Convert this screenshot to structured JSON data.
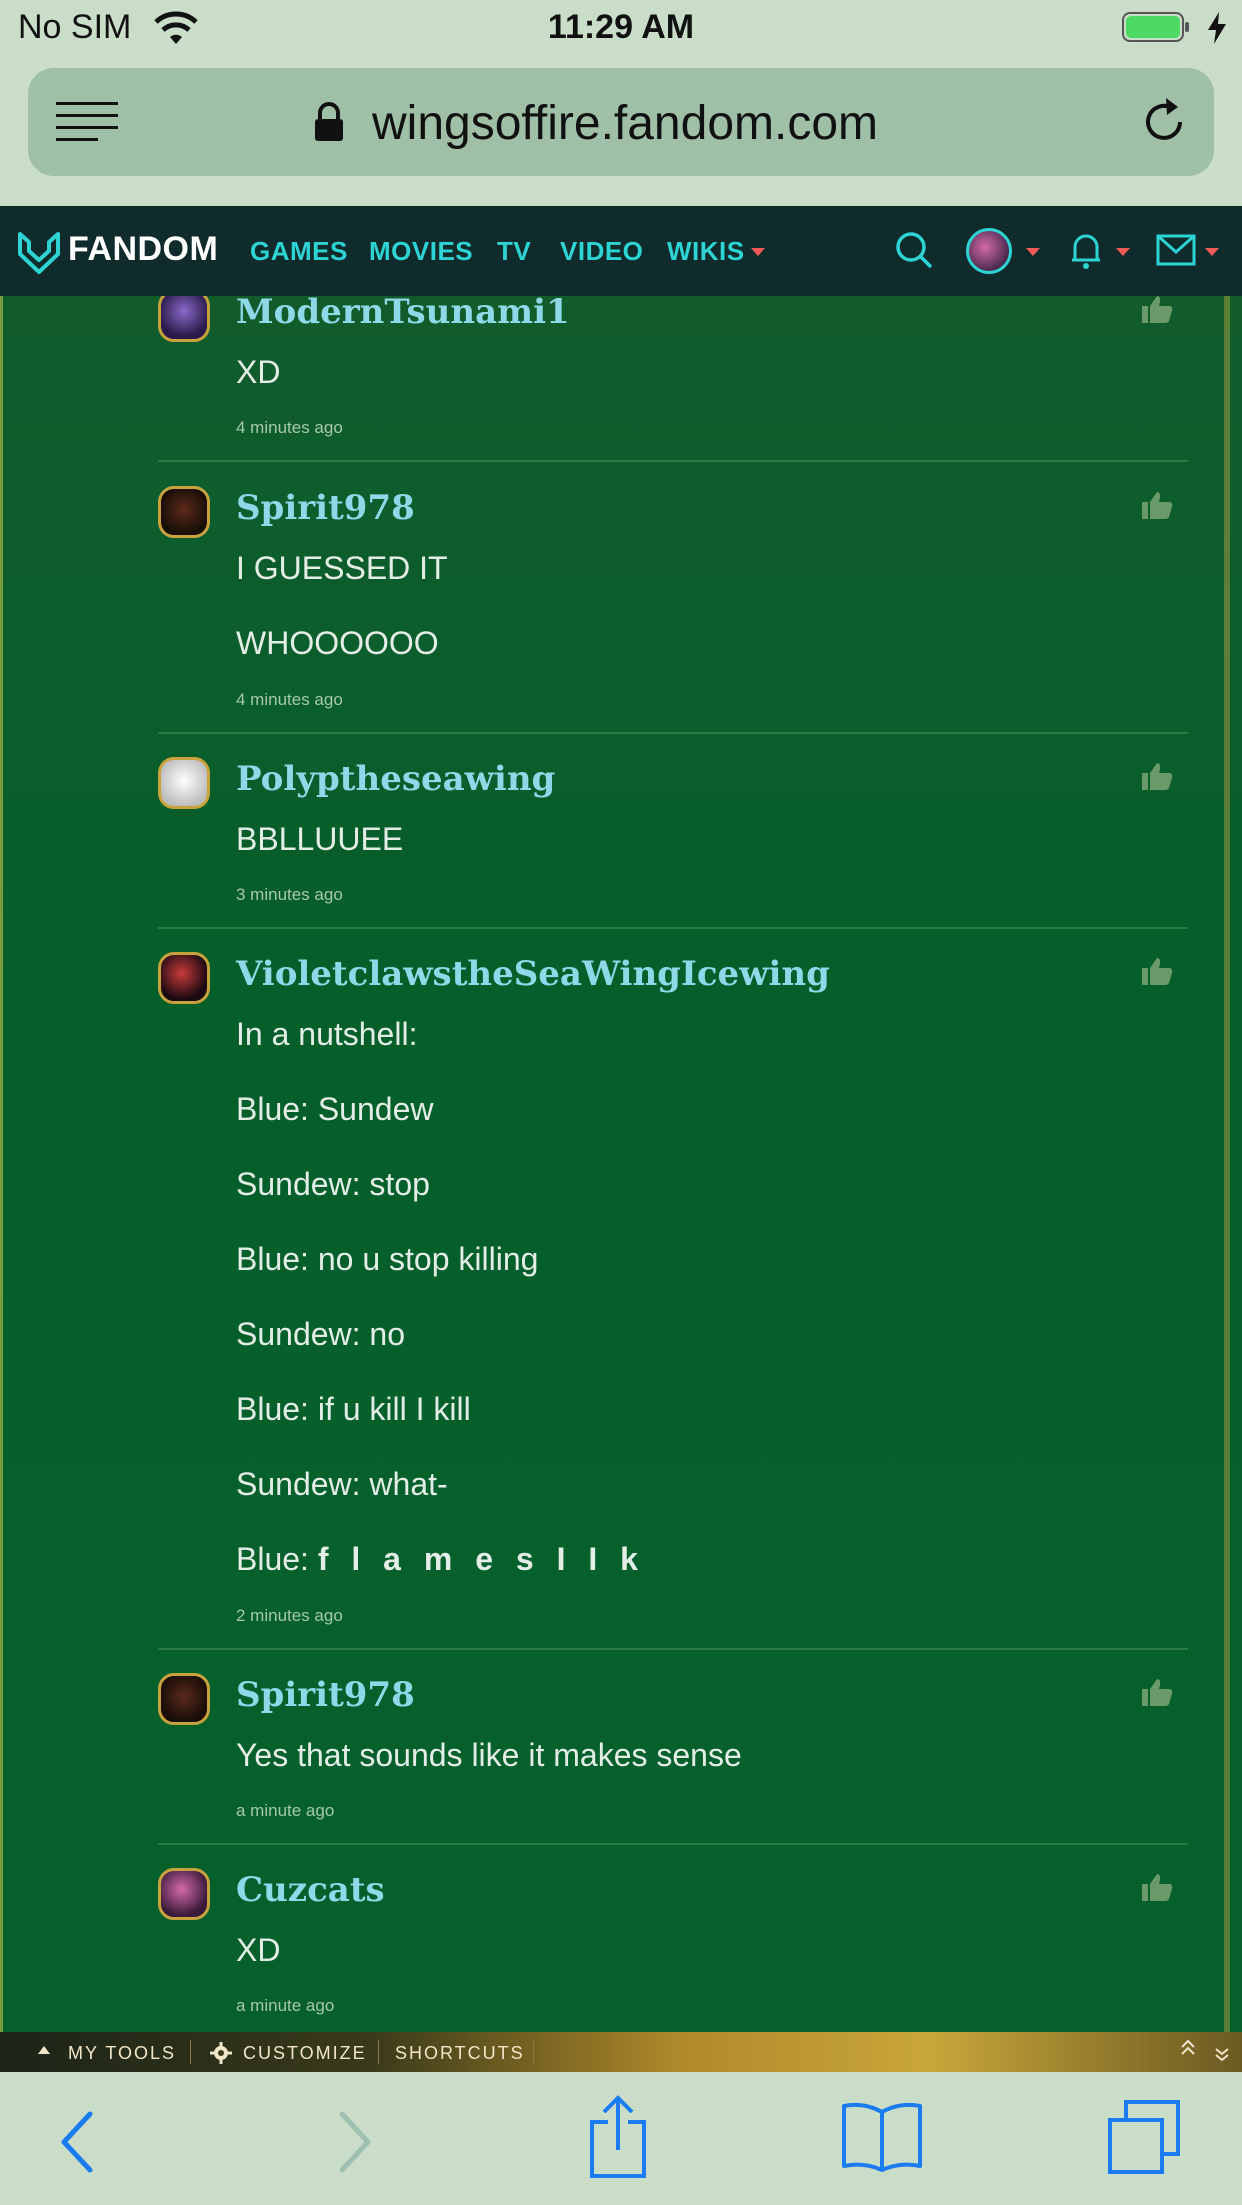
{
  "status_bar": {
    "carrier": "No SIM",
    "time": "11:29 AM",
    "battery_color": "#4cd964"
  },
  "browser": {
    "domain": "wingsoffire.fandom.com"
  },
  "fandom_nav": {
    "brand": "FANDOM",
    "links": [
      "GAMES",
      "MOVIES",
      "TV",
      "VIDEO",
      "WIKIS"
    ],
    "accent": "#2ed3d3"
  },
  "comments": [
    {
      "username": "ModernTsunami1",
      "lines": [
        "XD"
      ],
      "time": "4 minutes ago",
      "avatar": "purple-dragon"
    },
    {
      "username": "Spirit978",
      "lines": [
        "I GUESSED IT",
        "WHOOOOOO"
      ],
      "time": "4 minutes ago",
      "avatar": "dark-dragon"
    },
    {
      "username": "Polyptheseawing",
      "lines": [
        "BBLLUUEE"
      ],
      "time": "3 minutes ago",
      "avatar": "white-dragon"
    },
    {
      "username": "VioletclawstheSeaWingIcewing",
      "lines": [
        "In a nutshell:",
        "Blue: Sundew",
        "Sundew: stop",
        "Blue: no u stop killing",
        "Sundew: no",
        "Blue: if u kill I kill",
        "Sundew: what-",
        "Blue: "
      ],
      "bold_tail": "f l a m e s I I k",
      "time": "2 minutes ago",
      "avatar": "red-dragon"
    },
    {
      "username": "Spirit978",
      "lines": [
        "Yes that sounds like it makes sense"
      ],
      "time": "a minute ago",
      "avatar": "dark-dragon"
    },
    {
      "username": "Cuzcats",
      "lines": [
        "XD"
      ],
      "time": "a minute ago",
      "avatar": "pink-dragon"
    }
  ],
  "toolbar": {
    "my_tools": "MY TOOLS",
    "customize": "CUSTOMIZE",
    "shortcuts": "SHORTCUTS"
  }
}
